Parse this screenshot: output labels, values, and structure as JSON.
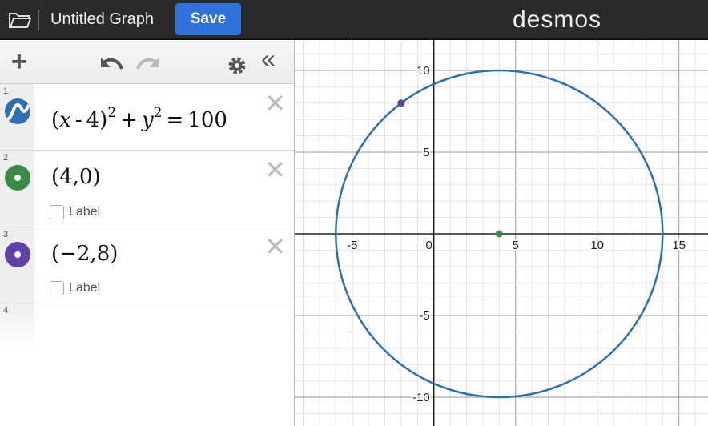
{
  "header": {
    "title": "Untitled Graph",
    "save_label": "Save",
    "logo": "desmos"
  },
  "toolbar": {
    "add": "+",
    "undo": "undo-icon",
    "redo": "redo-icon",
    "settings": "gear-icon",
    "collapse": "«"
  },
  "expressions": [
    {
      "num": "1",
      "latex": "(x-4)^2+y^2=100",
      "color": "#2d70b3",
      "icon": "curve-icon"
    },
    {
      "num": "2",
      "point": "(4,0)",
      "color": "#388c46",
      "label": "Label"
    },
    {
      "num": "3",
      "point": "(−2,8)",
      "color": "#6042a6",
      "label": "Label"
    },
    {
      "num": "4"
    }
  ],
  "graph": {
    "x_ticks": [
      "-5",
      "0",
      "5",
      "10",
      "15"
    ],
    "y_ticks": [
      "10",
      "5",
      "-5",
      "-10"
    ],
    "circle": {
      "cx": 4,
      "cy": 0,
      "r": 10,
      "color": "#2d70b3"
    },
    "points": [
      {
        "x": 4,
        "y": 0,
        "color": "#388c46"
      },
      {
        "x": -2,
        "y": 8,
        "color": "#6042a6"
      }
    ]
  }
}
